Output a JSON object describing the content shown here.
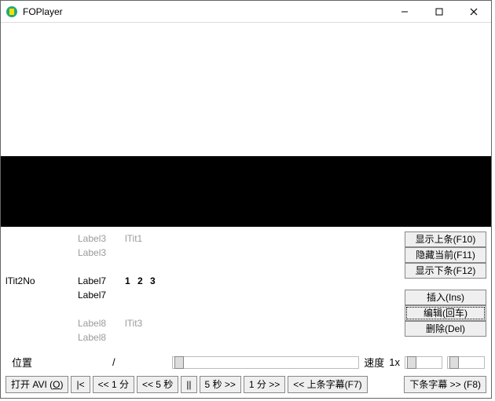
{
  "title": "FOPlayer",
  "labels": {
    "row1_a": "Label3",
    "row1_b": "lTit1",
    "row2_a": "Label3",
    "row3_left": "lTit2No",
    "row3_a": "Label7",
    "row3_b": "1 2 3",
    "row4_a": "Label7",
    "row5_a": "Label8",
    "row5_b": "lTit3",
    "row6_a": "Label8"
  },
  "side": {
    "show_prev": "显示上条(F10)",
    "hide_cur": "隐藏当前(F11)",
    "show_next": "显示下条(F12)",
    "insert": "插入(Ins)",
    "edit": "编辑(回车)",
    "delete": "删除(Del)"
  },
  "status": {
    "pos_label": "位置",
    "pos_sep": "/",
    "speed_label": "速度",
    "speed_value": "1x"
  },
  "bottom": {
    "open_avi_pre": "打开 AVI (",
    "open_avi_key": "O",
    "open_avi_post": ")",
    "go_start": "|<",
    "back1m": "<< 1 分",
    "back5s": "<< 5 秒",
    "pause": "||",
    "fwd5s": "5 秒 >>",
    "fwd1m": "1 分 >>",
    "prev_sub": "<< 上条字幕(F7)",
    "next_sub": "下条字幕 >> (F8)"
  }
}
